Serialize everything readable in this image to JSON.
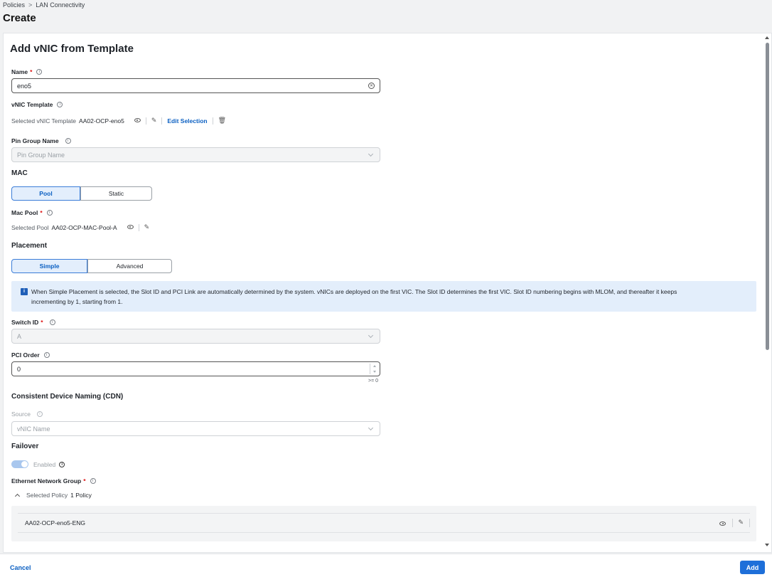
{
  "breadcrumb": {
    "parent": "Policies",
    "separator": ">",
    "current": "LAN Connectivity"
  },
  "page_title": "Create",
  "form": {
    "title": "Add vNIC from Template",
    "name": {
      "label": "Name",
      "required": "*",
      "value": "eno5"
    },
    "vnic_template": {
      "label": "vNIC Template",
      "selected_label": "Selected vNIC Template",
      "selected_value": "AA02-OCP-eno5",
      "edit_selection": "Edit Selection"
    },
    "pin_group": {
      "label": "Pin Group Name",
      "placeholder": "Pin Group Name"
    },
    "mac": {
      "heading": "MAC",
      "options": [
        "Pool",
        "Static"
      ],
      "selected": "Pool",
      "pool_label": "Mac Pool",
      "required": "*",
      "selected_label": "Selected Pool",
      "selected_value": "AA02-OCP-MAC-Pool-A"
    },
    "placement": {
      "heading": "Placement",
      "options": [
        "Simple",
        "Advanced"
      ],
      "selected": "Simple",
      "info_icon": "i",
      "info_line1": "When Simple Placement is selected, the Slot ID and PCI Link are automatically determined by the system. vNICs are deployed on the first VIC. The Slot ID determines the first VIC. Slot ID numbering begins with MLOM, and thereafter it keeps",
      "info_line2": "incrementing by 1, starting from 1."
    },
    "switch_id": {
      "label": "Switch ID",
      "required": "*",
      "value": "A"
    },
    "pci_order": {
      "label": "PCI Order",
      "value": "0",
      "hint": ">= 0"
    },
    "cdn": {
      "heading": "Consistent Device Naming (CDN)",
      "source_label": "Source",
      "source_value": "vNIC Name"
    },
    "failover": {
      "heading": "Failover",
      "state_label": "Enabled",
      "enabled": true
    },
    "ethernet_network_group": {
      "label": "Ethernet Network Group",
      "required": "*",
      "selected_label": "Selected Policy",
      "selected_count": "1 Policy",
      "policy_name": "AA02-OCP-eno5-ENG"
    }
  },
  "footer": {
    "cancel": "Cancel",
    "add": "Add"
  },
  "colors": {
    "accent": "#1e6fd9",
    "link": "#0a5fc2",
    "info_bg": "#e3eefb",
    "selected_bg": "#e3eefc"
  }
}
